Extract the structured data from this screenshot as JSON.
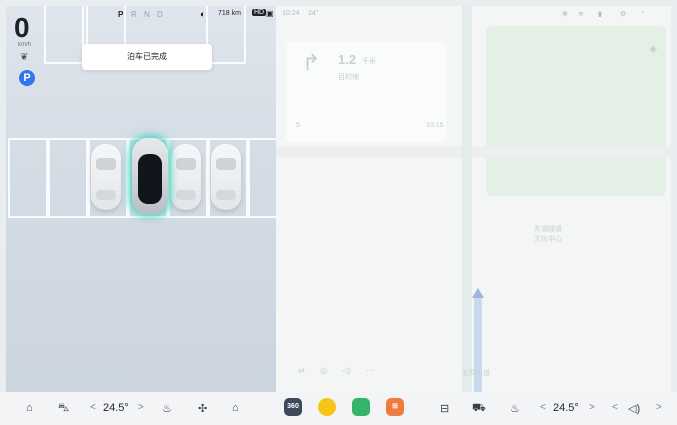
{
  "speed": {
    "value": "0",
    "unit": "km/h"
  },
  "gears": {
    "items": [
      "P",
      "R",
      "N",
      "D"
    ],
    "active": "P"
  },
  "range": {
    "text": "718 km"
  },
  "status_bar": {
    "time": "10:24",
    "temp": "24°"
  },
  "parking": {
    "toast": "泊车已完成"
  },
  "nav": {
    "distance": "1.2",
    "distance_unit": "千米",
    "road": "目的地",
    "eta_label": "5",
    "eta_time": "10:15"
  },
  "map": {
    "poi_label": "东湖绿道\n文化中心",
    "bottom_label": "五四大道"
  },
  "climate": {
    "left_temp": "24.5°",
    "right_temp": "24.5°",
    "prev": "<",
    "next": ">"
  },
  "apps": {
    "camera360_label": "360"
  },
  "accent": "#3574f0",
  "glow": "#3cd2be"
}
